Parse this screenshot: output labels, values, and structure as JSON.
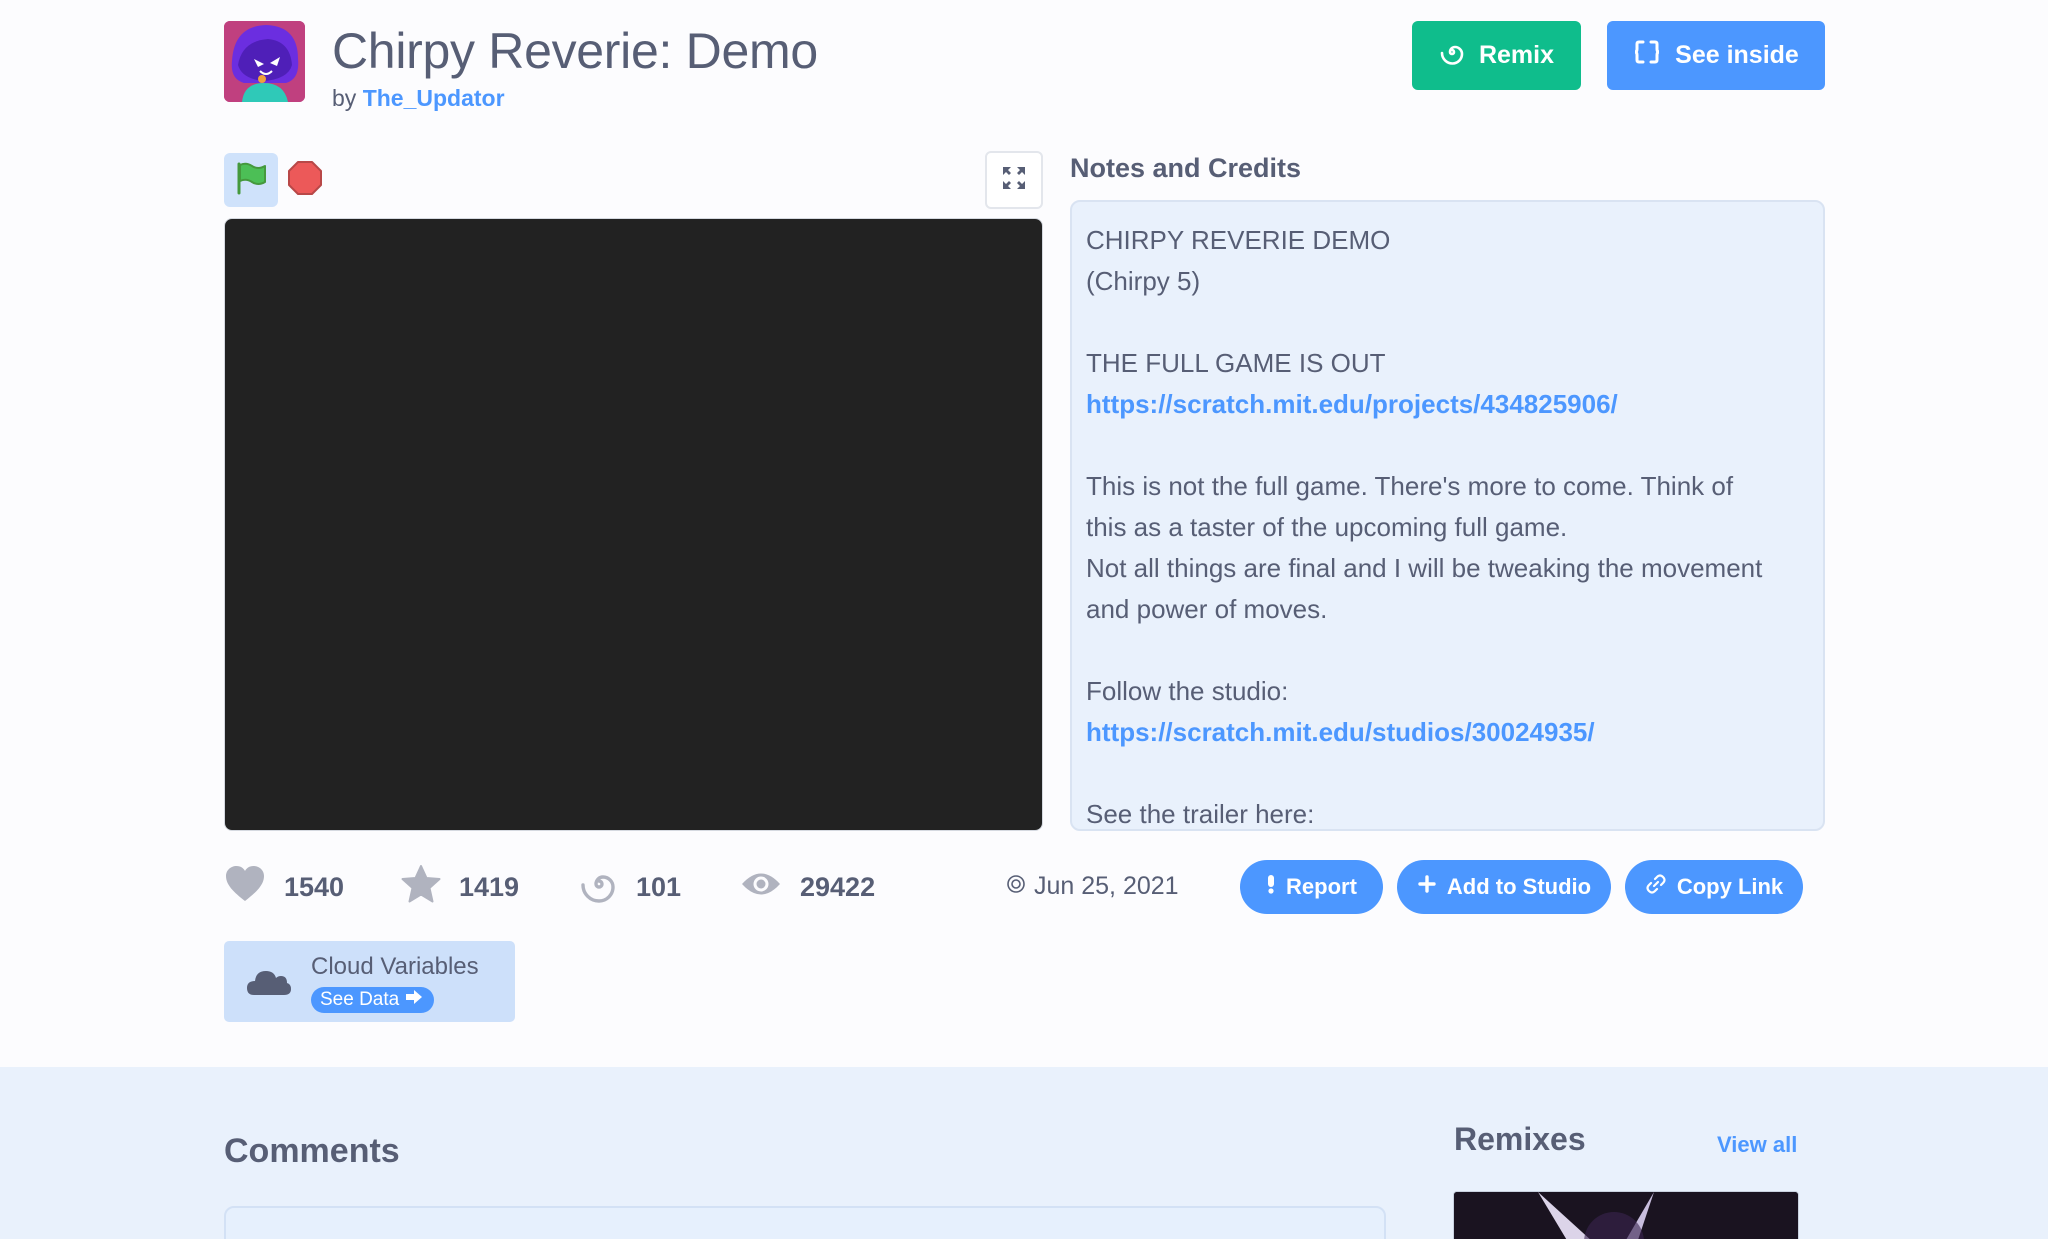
{
  "project": {
    "title": "Chirpy Reverie: Demo",
    "by_prefix": "by",
    "author": "The_Updator"
  },
  "header_buttons": {
    "remix_label": "Remix",
    "see_inside_label": "See inside"
  },
  "notes": {
    "label": "Notes and Credits",
    "lines": [
      "CHIRPY REVERIE DEMO",
      "(Chirpy 5)",
      "",
      "THE FULL GAME IS OUT",
      "https://scratch.mit.edu/projects/434825906/",
      "",
      "This is not the full game. There's more to come. Think of",
      "this as a taster of the upcoming full game.",
      "Not all things are final and I will be tweaking the movement",
      "and power of moves.",
      "",
      "Follow the studio:",
      "https://scratch.mit.edu/studios/30024935/",
      "",
      "See the trailer here:"
    ]
  },
  "stats": {
    "loves": "1540",
    "favorites": "1419",
    "remixes": "101",
    "views": "29422"
  },
  "date": "Jun 25, 2021",
  "actions": {
    "report_label": "Report",
    "add_to_studio_label": "Add to Studio",
    "copy_link_label": "Copy Link"
  },
  "cloud": {
    "title": "Cloud Variables",
    "button_label": "See Data"
  },
  "comments": {
    "title": "Comments"
  },
  "remixes": {
    "title": "Remixes",
    "view_all_label": "View all"
  },
  "icons": {
    "green_flag": "green-flag-icon",
    "stop": "stop-icon",
    "fullscreen": "fullscreen-icon",
    "love": "heart-icon",
    "favorite": "star-icon",
    "remix": "remix-spiral-icon",
    "views": "eye-icon",
    "cloud": "cloud-icon"
  },
  "colors": {
    "remix_green": "#0fbd8c",
    "scratch_blue": "#4c97ff",
    "stage_black": "#222222",
    "text": "#575e75"
  }
}
